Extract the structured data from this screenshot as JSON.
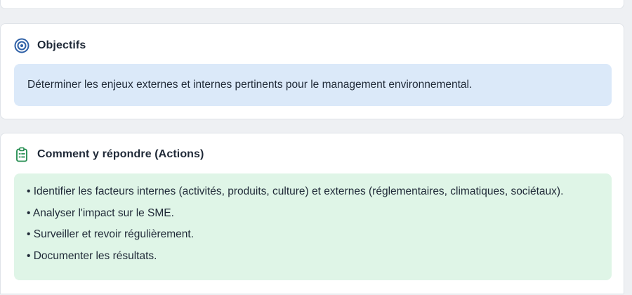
{
  "objectives": {
    "title": "Objectifs",
    "icon": "target-icon",
    "accent": "#2d5fa6",
    "text": "Déterminer les enjeux externes et internes pertinents pour le management environnemental."
  },
  "actions": {
    "title": "Comment y répondre (Actions)",
    "icon": "clipboard-list-icon",
    "accent": "#1f8a4c",
    "items": [
      "• Identifier les facteurs internes (activités, produits, culture) et externes (réglementaires, climatiques, sociétaux).",
      "• Analyser l'impact sur le SME.",
      "• Surveiller et revoir régulièrement.",
      "• Documenter les résultats."
    ]
  }
}
